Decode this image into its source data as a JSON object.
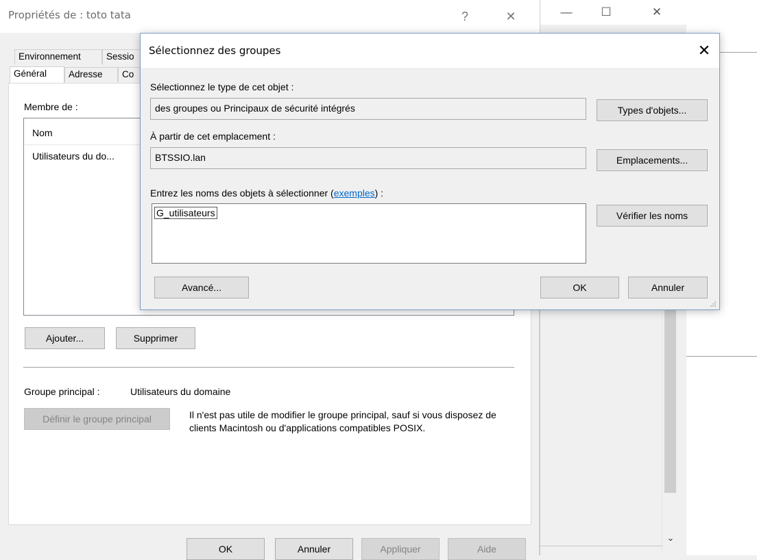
{
  "props_window": {
    "title": "Propriétés de : toto tata",
    "help_glyph": "?",
    "close_glyph": "✕",
    "tabs_row1": [
      "Environnement",
      "Sessio"
    ],
    "tabs_row2": [
      "Général",
      "Adresse",
      "Co"
    ],
    "member_of_label": "Membre de :",
    "list_header_name": "Nom",
    "list_rows": [
      "Utilisateurs du do..."
    ],
    "add_button": "Ajouter...",
    "remove_button": "Supprimer",
    "primary_group_label": "Groupe principal :",
    "primary_group_value": "Utilisateurs du domaine",
    "set_primary_button": "Définir le groupe principal",
    "primary_group_note": "Il n'est pas utile de modifier le groupe principal, sauf si vous disposez de clients Macintosh ou d'applications compatibles POSIX.",
    "ok_button": "OK",
    "cancel_button": "Annuler",
    "apply_button": "Appliquer",
    "help_button": "Aide"
  },
  "bg_window": {
    "minimize_glyph": "—",
    "maximize_glyph": "☐",
    "close_glyph": "✕",
    "scroll_down_glyph": "⌄"
  },
  "dialog": {
    "title": "Sélectionnez des groupes",
    "close_glyph": "✕",
    "object_type_label": "Sélectionnez le type de cet objet :",
    "object_type_value": "des groupes ou Principaux de sécurité intégrés",
    "object_types_button": "Types d'objets...",
    "location_label": "À partir de cet emplacement :",
    "location_value": "BTSSIO.lan",
    "locations_button": "Emplacements...",
    "names_label_prefix": "Entrez les noms des objets à sélectionner (",
    "names_label_link": "exemples",
    "names_label_suffix": ") :",
    "names_value": "G_utilisateurs",
    "check_names_button": "Vérifier les noms",
    "advanced_button": "Avancé...",
    "ok_button": "OK",
    "cancel_button": "Annuler"
  }
}
